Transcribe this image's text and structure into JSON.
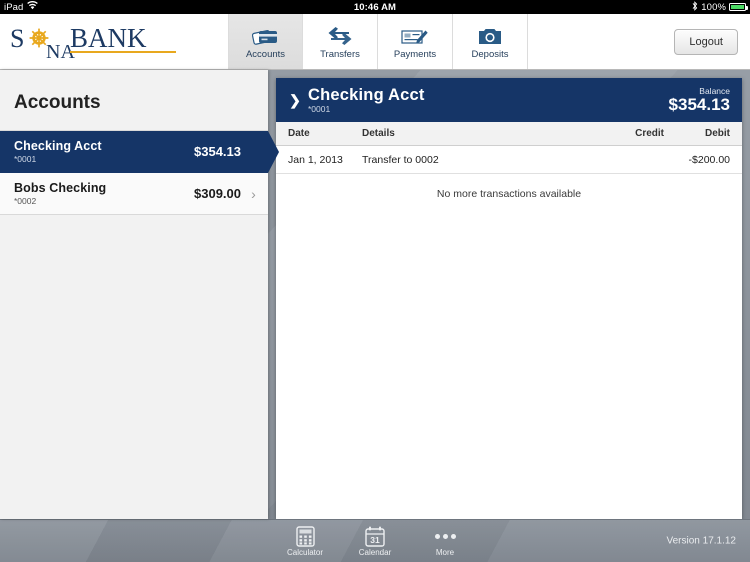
{
  "status_bar": {
    "device": "iPad",
    "wifi_icon": "wifi-icon",
    "time": "10:46 AM",
    "bluetooth_icon": "bluetooth-icon",
    "battery_percent": "100%"
  },
  "brand": {
    "name": "SONABANK",
    "part1": "S",
    "wheel_icon": "ships-wheel-icon",
    "part2": "NA",
    "part3": "BANK",
    "navy": "#1d3a63",
    "gold": "#e8a81e"
  },
  "topnav": {
    "tabs": [
      {
        "label": "Accounts",
        "icon": "credit-cards-icon",
        "active": true
      },
      {
        "label": "Transfers",
        "icon": "transfer-arrows-icon",
        "active": false
      },
      {
        "label": "Payments",
        "icon": "check-pen-icon",
        "active": false
      },
      {
        "label": "Deposits",
        "icon": "camera-icon",
        "active": false
      }
    ],
    "logout_label": "Logout"
  },
  "sidebar": {
    "title": "Accounts",
    "accounts": [
      {
        "name": "Checking Acct",
        "number": "*0001",
        "amount": "$354.13",
        "selected": true
      },
      {
        "name": "Bobs Checking",
        "number": "*0002",
        "amount": "$309.00",
        "selected": false
      }
    ]
  },
  "detail": {
    "chevron_icon": "chevron-right-icon",
    "title": "Checking Acct",
    "number": "*0001",
    "balance_label": "Balance",
    "balance_value": "$354.13",
    "columns": {
      "date": "Date",
      "details": "Details",
      "credit": "Credit",
      "debit": "Debit"
    },
    "transactions": [
      {
        "date": "Jan 1, 2013",
        "details": "Transfer to 0002",
        "credit": "",
        "debit": "-$200.00"
      }
    ],
    "empty_message": "No more transactions available"
  },
  "bottombar": {
    "items": [
      {
        "label": "Calculator",
        "icon": "calculator-icon"
      },
      {
        "label": "Calendar",
        "icon": "calendar-icon",
        "day": "31"
      },
      {
        "label": "More",
        "icon": "ellipsis-icon"
      }
    ],
    "version": "Version 17.1.12"
  }
}
